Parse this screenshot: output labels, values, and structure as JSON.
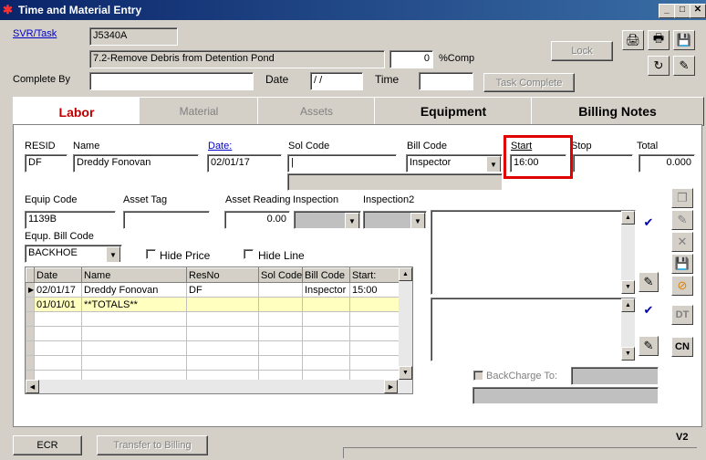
{
  "window": {
    "title": "Time and Material Entry"
  },
  "header": {
    "svr_task_link": "SVR/Task",
    "task_code": "J5340A",
    "task_desc": "7.2-Remove Debris from Detention Pond",
    "percent_value": "0",
    "percent_label": "%Comp",
    "lock_label": "Lock",
    "complete_by_label": "Complete By",
    "complete_by_value": "",
    "date_label": "Date",
    "date_value": " / /",
    "time_label": "Time",
    "time_value": "",
    "task_complete_label": "Task Complete"
  },
  "tabs": [
    "Labor",
    "Material",
    "Assets",
    "Equipment",
    "Billing Notes"
  ],
  "labor": {
    "resid_label": "RESID",
    "resid_value": "DF",
    "name_label": "Name",
    "name_value": "Dreddy Fonovan",
    "date_label": "Date:",
    "date_value": "02/01/17",
    "sol_code_label": "Sol Code",
    "sol_code_value": "|",
    "bill_code_label": "Bill Code",
    "bill_code_value": "Inspector",
    "start_label": "Start",
    "start_value": "16:00",
    "stop_label": "Stop",
    "stop_value": "",
    "total_label": "Total",
    "total_value": "0.000",
    "equip_code_label": "Equip Code",
    "equip_code_value": "1139B",
    "asset_tag_label": "Asset Tag",
    "asset_tag_value": "",
    "asset_reading_label": "Asset Reading",
    "asset_reading_value": "0.00",
    "inspection_label": "Inspection",
    "inspection2_label": "Inspection2",
    "equp_bill_code_label": "Equp. Bill Code",
    "equp_bill_code_value": "BACKHOE",
    "hide_price_label": "Hide Price",
    "hide_line_label": "Hide Line",
    "backcharge_label": "BackCharge To:"
  },
  "grid": {
    "columns": [
      "Date",
      "Name",
      "ResNo",
      "Sol Code",
      "Bill Code",
      "Start:"
    ],
    "rows": [
      [
        "02/01/17",
        "Dreddy Fonovan",
        "DF",
        "",
        "Inspector",
        "15:00"
      ],
      [
        "01/01/01",
        "**TOTALS**",
        "",
        "",
        "",
        ""
      ]
    ]
  },
  "side_buttons": {
    "dt": "DT",
    "cn": "CN"
  },
  "footer": {
    "ecr_label": "ECR",
    "transfer_label": "Transfer to Billing",
    "version": "V2"
  },
  "colors": {
    "title_bar": "#0a246a",
    "highlight_box": "#e00000",
    "totals_row": "#ffffc0",
    "active_tab_text": "#c00000"
  }
}
